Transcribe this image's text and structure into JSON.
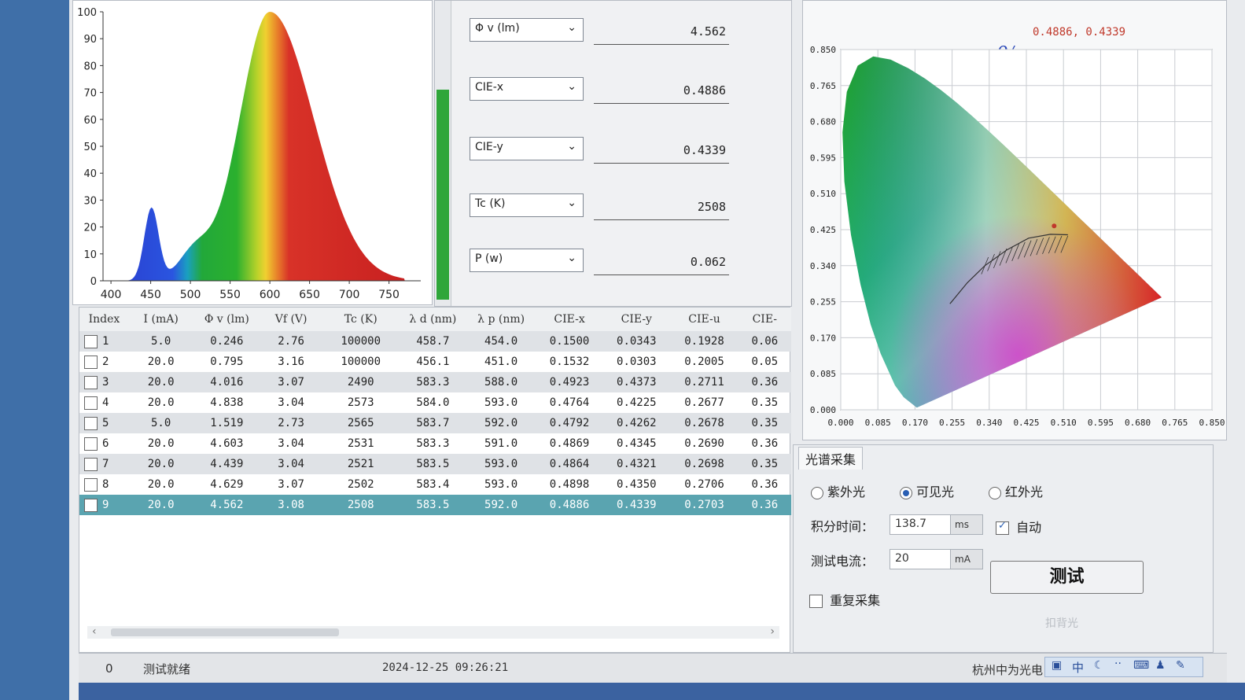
{
  "spectrum": {
    "y_ticks": [
      "100",
      "90",
      "80",
      "70",
      "60",
      "50",
      "40",
      "30",
      "20",
      "10",
      "0"
    ],
    "x_ticks": [
      "400",
      "450",
      "500",
      "550",
      "600",
      "650",
      "700",
      "750"
    ]
  },
  "measurements": [
    {
      "param": "Φ v (lm)",
      "value": "4.562"
    },
    {
      "param": "CIE-x",
      "value": "0.4886"
    },
    {
      "param": "CIE-y",
      "value": "0.4339"
    },
    {
      "param": "Tc (K)",
      "value": "2508"
    },
    {
      "param": "P (w)",
      "value": "0.062"
    }
  ],
  "level_meter": {
    "fill_fraction": 0.71
  },
  "cie": {
    "coord_readout": "0.4886, 0.4339",
    "annotation": "0/",
    "y_ticks": [
      "0.850",
      "0.765",
      "0.680",
      "0.595",
      "0.510",
      "0.425",
      "0.340",
      "0.255",
      "0.170",
      "0.085",
      "0.000"
    ],
    "x_ticks": [
      "0.000",
      "0.085",
      "0.170",
      "0.255",
      "0.340",
      "0.425",
      "0.510",
      "0.595",
      "0.680",
      "0.765",
      "0.850"
    ],
    "marker": {
      "x": 0.4886,
      "y": 0.4339
    }
  },
  "table": {
    "columns": [
      "Index",
      "I (mA)",
      "Φ v (lm)",
      "Vf (V)",
      "Tc (K)",
      "λ d (nm)",
      "λ p (nm)",
      "CIE-x",
      "CIE-y",
      "CIE-u",
      "CIE-"
    ],
    "rows": [
      [
        "1",
        "5.0",
        "0.246",
        "2.76",
        "100000",
        "458.7",
        "454.0",
        "0.1500",
        "0.0343",
        "0.1928",
        "0.06"
      ],
      [
        "2",
        "20.0",
        "0.795",
        "3.16",
        "100000",
        "456.1",
        "451.0",
        "0.1532",
        "0.0303",
        "0.2005",
        "0.05"
      ],
      [
        "3",
        "20.0",
        "4.016",
        "3.07",
        "2490",
        "583.3",
        "588.0",
        "0.4923",
        "0.4373",
        "0.2711",
        "0.36"
      ],
      [
        "4",
        "20.0",
        "4.838",
        "3.04",
        "2573",
        "584.0",
        "593.0",
        "0.4764",
        "0.4225",
        "0.2677",
        "0.35"
      ],
      [
        "5",
        "5.0",
        "1.519",
        "2.73",
        "2565",
        "583.7",
        "592.0",
        "0.4792",
        "0.4262",
        "0.2678",
        "0.35"
      ],
      [
        "6",
        "20.0",
        "4.603",
        "3.04",
        "2531",
        "583.3",
        "591.0",
        "0.4869",
        "0.4345",
        "0.2690",
        "0.36"
      ],
      [
        "7",
        "20.0",
        "4.439",
        "3.04",
        "2521",
        "583.5",
        "593.0",
        "0.4864",
        "0.4321",
        "0.2698",
        "0.35"
      ],
      [
        "8",
        "20.0",
        "4.629",
        "3.07",
        "2502",
        "583.4",
        "593.0",
        "0.4898",
        "0.4350",
        "0.2706",
        "0.36"
      ],
      [
        "9",
        "20.0",
        "4.562",
        "3.08",
        "2508",
        "583.5",
        "592.0",
        "0.4886",
        "0.4339",
        "0.2703",
        "0.36"
      ]
    ],
    "selected_row_index": 8
  },
  "acquisition": {
    "title": "光谱采集",
    "modes": [
      {
        "label": "紫外光",
        "selected": false
      },
      {
        "label": "可见光",
        "selected": true
      },
      {
        "label": "红外光",
        "selected": false
      }
    ],
    "integration_label": "积分时间：",
    "integration_value": "138.7",
    "integration_unit": "ms",
    "auto_label": "自动",
    "auto_checked": true,
    "current_label": "测试电流：",
    "current_value": "20",
    "current_unit": "mA",
    "test_button": "测试",
    "repeat_label": "重复采集",
    "faded_label": "扣背光"
  },
  "status": {
    "count": "0",
    "message": "测试就绪",
    "datetime": "2024-12-25 09:26:21",
    "company": "杭州中为光电",
    "ime_label": "中"
  },
  "colors": {
    "selected_row": "#5aa4b0",
    "level": "#2fa63a",
    "marker": "#c0392b"
  }
}
